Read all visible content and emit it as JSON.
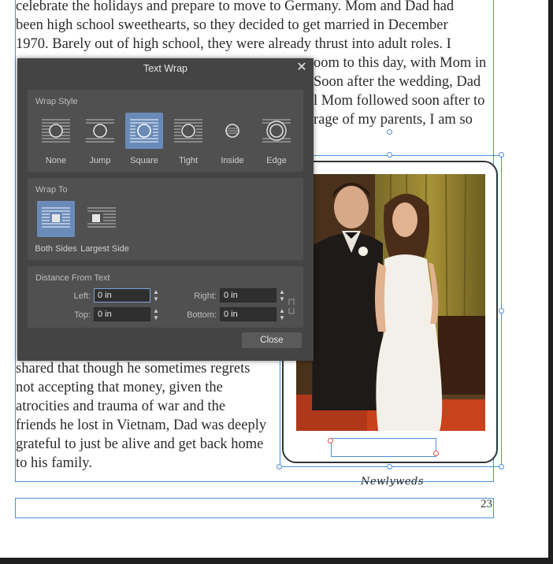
{
  "document": {
    "top_lines": [
      "celebrate the holidays and prepare to move to Germany. Mom and Dad had",
      "been high school sweethearts, so they decided to get married in December",
      "1970. Barely out of high school, they were already thrust into adult roles. I"
    ],
    "partial_right_lines": [
      "oom to this day, with Mom in",
      " Soon after the wedding, Dad",
      "l Mom followed soon after to",
      "rage of my parents, I am so"
    ],
    "column_lines": [
      "shared that though he sometimes regrets",
      "not accepting that money, given the",
      "atrocities and trauma of war and the",
      "friends he lost in Vietnam, Dad was deeply",
      "grateful to just be alive and get back home",
      "to his family."
    ],
    "photo_caption": "Newlyweds",
    "page_number": "23"
  },
  "dialog": {
    "title": "Text Wrap",
    "close_glyph": "✕",
    "wrap_style": {
      "label": "Wrap Style",
      "options": [
        "None",
        "Jump",
        "Square",
        "Tight",
        "Inside",
        "Edge"
      ],
      "selected": "Square"
    },
    "wrap_to": {
      "label": "Wrap To",
      "options": [
        "Both Sides",
        "Largest Side"
      ],
      "selected": "Both Sides"
    },
    "distance": {
      "label": "Distance From Text",
      "left_label": "Left:",
      "left_value": "0 in",
      "right_label": "Right:",
      "right_value": "0 in",
      "top_label": "Top:",
      "top_value": "0 in",
      "bottom_label": "Bottom:",
      "bottom_value": "0 in"
    },
    "close_label": "Close"
  },
  "colors": {
    "dialog_bg": "#444444",
    "section_bg": "#505050",
    "selected": "#6a8bb8",
    "guide": "#4a90d9"
  }
}
